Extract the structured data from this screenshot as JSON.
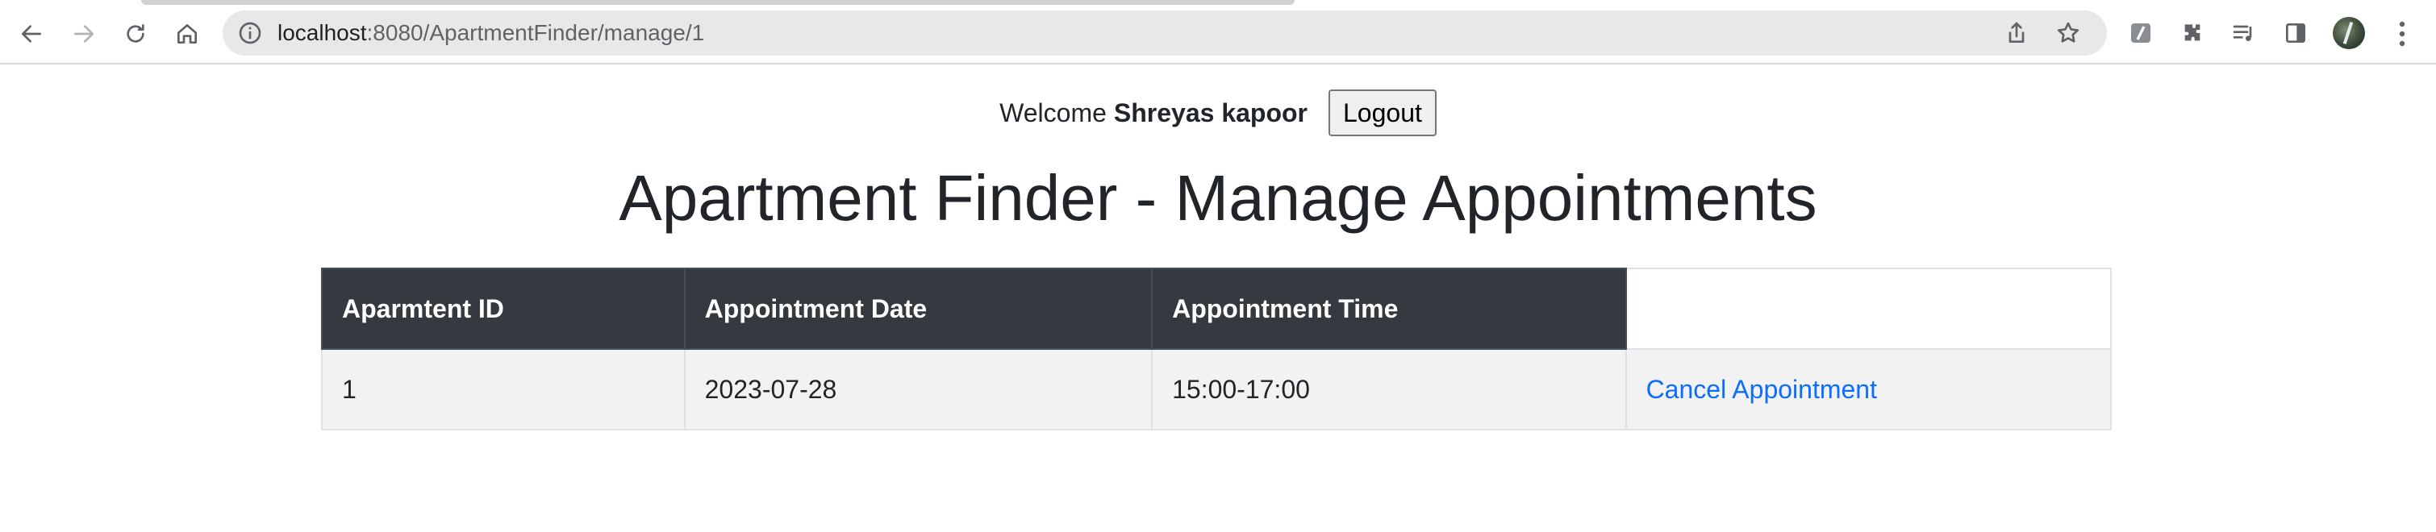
{
  "browser": {
    "url_host": "localhost",
    "url_rest": ":8080/ApartmentFinder/manage/1",
    "icons": [
      "back-icon",
      "forward-icon",
      "reload-icon",
      "home-icon",
      "info-icon",
      "share-icon",
      "star-icon",
      "extension-icon",
      "puzzle-icon",
      "media-icon",
      "sidepanel-icon",
      "avatar",
      "menu-icon"
    ]
  },
  "header": {
    "welcome_label": "Welcome",
    "user_name": "Shreyas kapoor",
    "logout_label": "Logout"
  },
  "page": {
    "title": "Apartment Finder - Manage Appointments"
  },
  "table": {
    "headers": [
      "Aparmtent ID",
      "Appointment Date",
      "Appointment Time",
      ""
    ],
    "rows": [
      {
        "apartment_id": "1",
        "date": "2023-07-28",
        "time": "15:00-17:00",
        "action": "Cancel Appointment"
      }
    ]
  },
  "colors": {
    "header_bg": "#343a40",
    "row_bg": "#f2f2f2",
    "link": "#0d6efd",
    "text": "#212529"
  }
}
